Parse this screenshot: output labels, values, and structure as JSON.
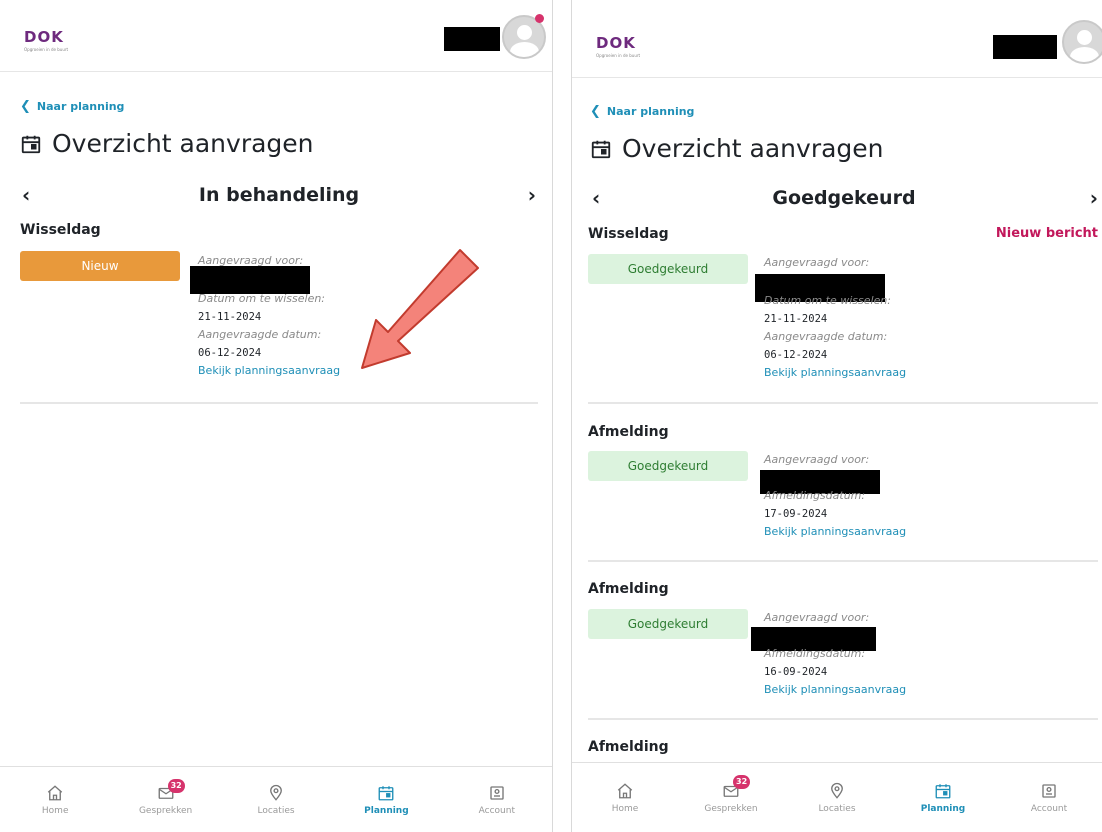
{
  "app": {
    "logo_text": "DOK",
    "logo_tagline": "Opgroeien in de buurt",
    "back_label": "Naar planning",
    "page_title": "Overzicht aanvragen"
  },
  "left": {
    "status": "In behandeling",
    "requests": [
      {
        "type": "Wisseldag",
        "badge": "Nieuw",
        "requested_for_label": "Aangevraagd voor:",
        "swap_date_label": "Datum om te wisselen:",
        "swap_date": "21-11-2024",
        "requested_date_label": "Aangevraagde datum:",
        "requested_date": "06-12-2024",
        "link": "Bekijk planningsaanvraag"
      }
    ]
  },
  "right": {
    "status": "Goedgekeurd",
    "new_message": "Nieuw bericht",
    "requests": [
      {
        "type": "Wisseldag",
        "badge": "Goedgekeurd",
        "requested_for_label": "Aangevraagd voor:",
        "swap_date_label": "Datum om te wisselen:",
        "swap_date": "21-11-2024",
        "requested_date_label": "Aangevraagde datum:",
        "requested_date": "06-12-2024",
        "link": "Bekijk planningsaanvraag"
      },
      {
        "type": "Afmelding",
        "badge": "Goedgekeurd",
        "requested_for_label": "Aangevraagd voor:",
        "date_label": "Afmeldingsdatum:",
        "date": "17-09-2024",
        "link": "Bekijk planningsaanvraag"
      },
      {
        "type": "Afmelding",
        "badge": "Goedgekeurd",
        "requested_for_label": "Aangevraagd voor:",
        "date_label": "Afmeldingsdatum:",
        "date": "16-09-2024",
        "link": "Bekijk planningsaanvraag"
      },
      {
        "type": "Afmelding"
      }
    ]
  },
  "nav": {
    "items": [
      {
        "label": "Home",
        "icon": "home-icon"
      },
      {
        "label": "Gesprekken",
        "icon": "mail-icon",
        "badge": "32"
      },
      {
        "label": "Locaties",
        "icon": "location-pin-icon"
      },
      {
        "label": "Planning",
        "icon": "calendar-icon",
        "active": true
      },
      {
        "label": "Account",
        "icon": "account-icon"
      }
    ]
  },
  "colors": {
    "accent": "#1f8fb7",
    "new_badge": "#e8993b",
    "approved_badge_bg": "#dcf3de",
    "approved_badge_text": "#2e7d32",
    "notification": "#d6336c",
    "annotation_arrow": "#f4837a"
  }
}
